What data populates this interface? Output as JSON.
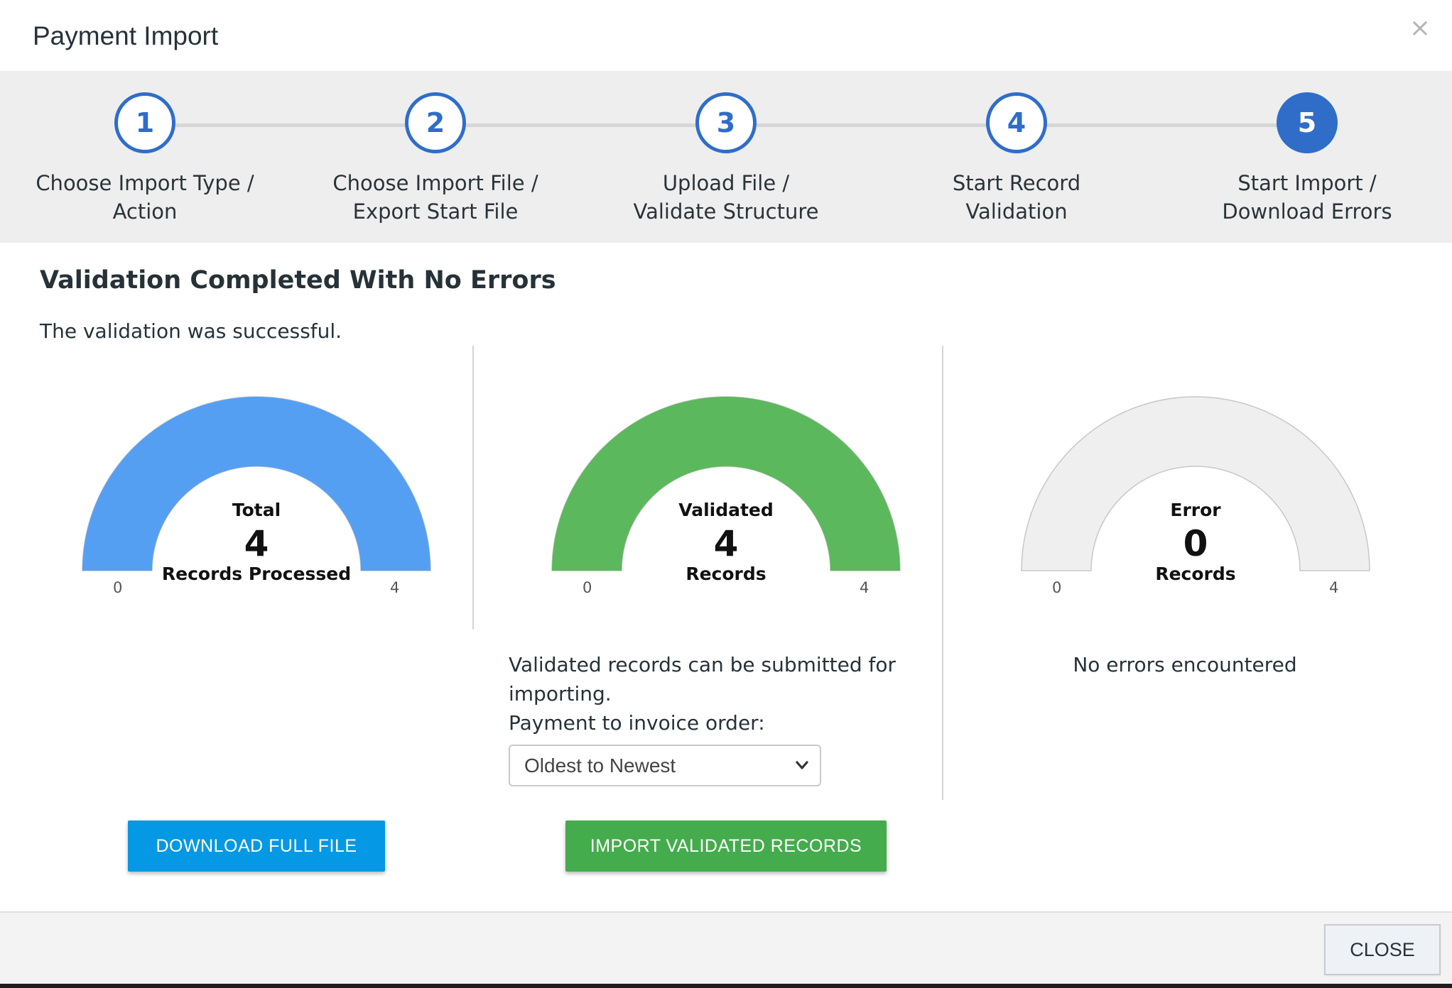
{
  "modal": {
    "title": "Payment Import",
    "close_icon": "×"
  },
  "steps": [
    {
      "number": "1",
      "line1": "Choose Import Type /",
      "line2": "Action",
      "state": "complete"
    },
    {
      "number": "2",
      "line1": "Choose Import File /",
      "line2": "Export Start File",
      "state": "complete"
    },
    {
      "number": "3",
      "line1": "Upload File /",
      "line2": "Validate Structure",
      "state": "complete"
    },
    {
      "number": "4",
      "line1": "Start Record",
      "line2": "Validation",
      "state": "complete"
    },
    {
      "number": "5",
      "line1": "Start Import /",
      "line2": "Download Errors",
      "state": "active"
    }
  ],
  "content": {
    "heading": "Validation Completed With No Errors",
    "subtext": "The validation was successful."
  },
  "gauges": [
    {
      "title": "Total",
      "value": "4",
      "caption": "Records Processed",
      "min": "0",
      "max": "4",
      "fill_fraction": 1,
      "color": "#559ff3"
    },
    {
      "title": "Validated",
      "value": "4",
      "caption": "Records",
      "min": "0",
      "max": "4",
      "fill_fraction": 1,
      "color": "#5cb85c"
    },
    {
      "title": "Error",
      "value": "0",
      "caption": "Records",
      "min": "0",
      "max": "4",
      "fill_fraction": 0,
      "color": "#efefef"
    }
  ],
  "validated_panel": {
    "note_line1": "Validated records can be submitted for",
    "note_line2": "importing.",
    "order_label": "Payment to invoice order:",
    "order_selected": "Oldest to Newest"
  },
  "error_panel": {
    "note": "No errors encountered"
  },
  "buttons": {
    "download": "DOWNLOAD FULL FILE",
    "import": "IMPORT VALIDATED RECORDS",
    "close": "CLOSE"
  },
  "colors": {
    "step_blue": "#2f6dc9",
    "download_button": "#0598e4",
    "import_button": "#44ac4c"
  }
}
